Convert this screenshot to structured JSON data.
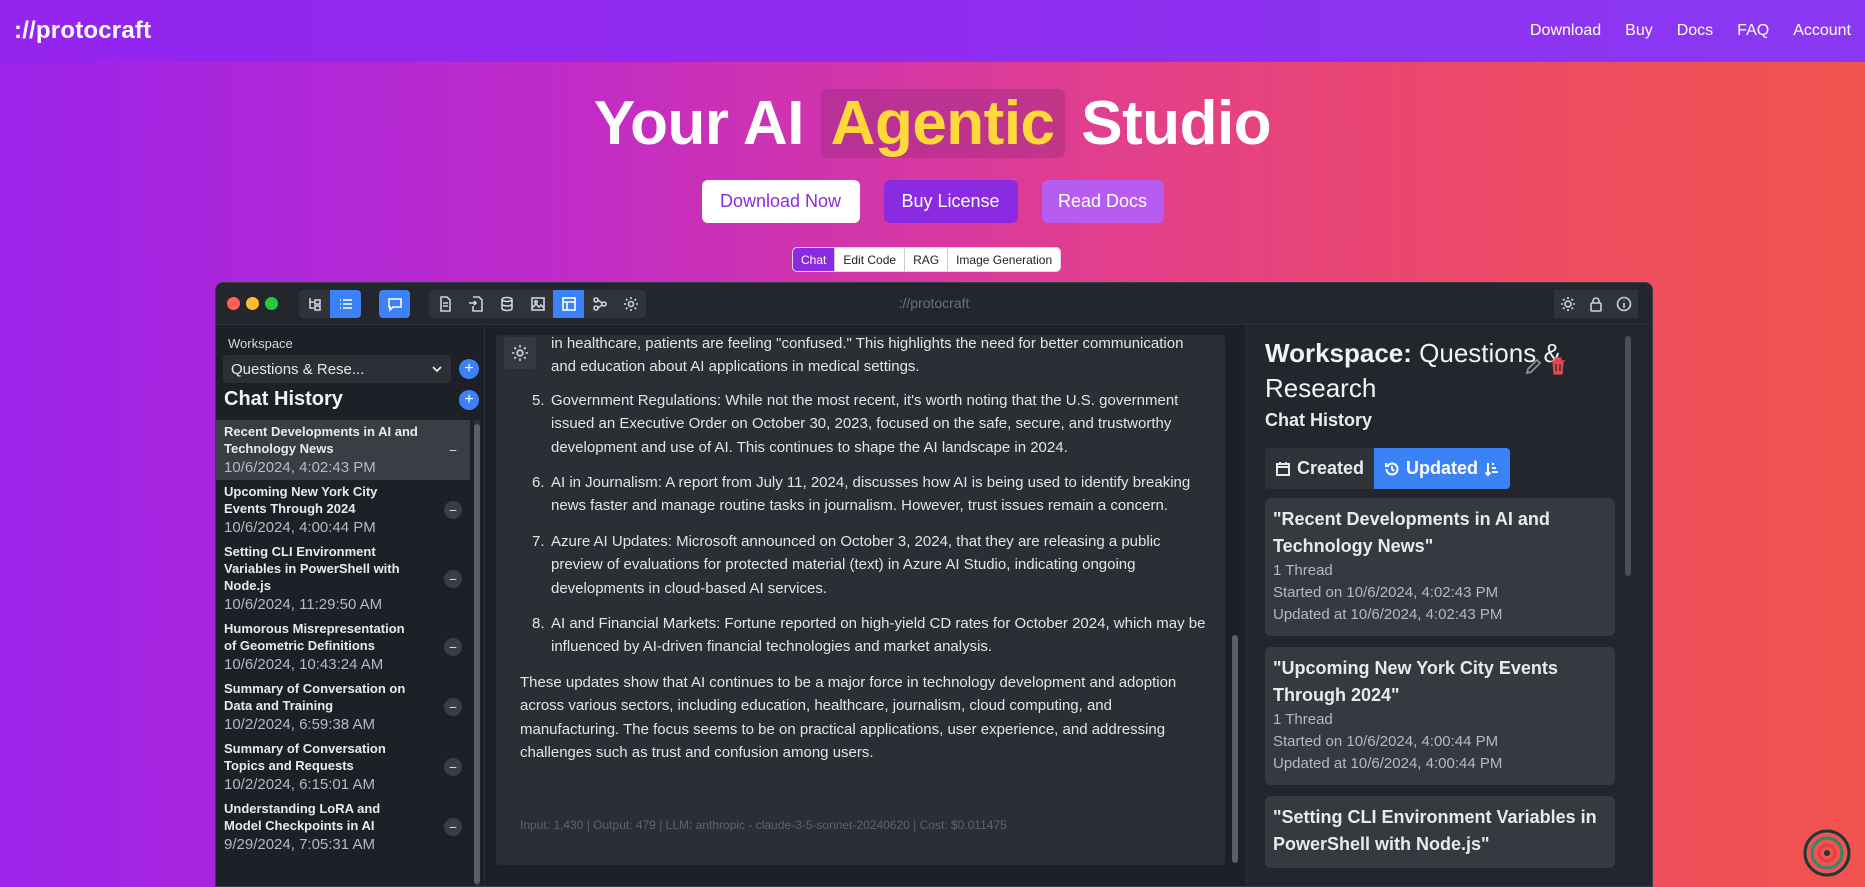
{
  "nav": {
    "logo": "://protocraft",
    "links": [
      "Download",
      "Buy",
      "Docs",
      "FAQ",
      "Account"
    ]
  },
  "hero": {
    "title_pre": "Your AI",
    "title_highlight": "Agentic",
    "title_post": "Studio",
    "buttons": [
      "Download Now",
      "Buy License",
      "Read Docs"
    ],
    "mode_tabs": [
      "Chat",
      "Edit Code",
      "RAG",
      "Image Generation"
    ],
    "active_tab": "Chat"
  },
  "window": {
    "title": "://protocraft"
  },
  "sidebar": {
    "workspace_label": "Workspace",
    "workspace_value": "Questions & Rese...",
    "chat_history_title": "Chat History",
    "chats": [
      {
        "title": "Recent Developments in AI and Technology News",
        "date": "10/6/2024, 4:02:43 PM"
      },
      {
        "title": "Upcoming New York City Events Through 2024",
        "date": "10/6/2024, 4:00:44 PM"
      },
      {
        "title": "Setting CLI Environment Variables in PowerShell with Node.js",
        "date": "10/6/2024, 11:29:50 AM"
      },
      {
        "title": "Humorous Misrepresentation of Geometric Definitions",
        "date": "10/6/2024, 10:43:24 AM"
      },
      {
        "title": "Summary of Conversation on Data and Training",
        "date": "10/2/2024, 6:59:38 AM"
      },
      {
        "title": "Summary of Conversation Topics and Requests",
        "date": "10/2/2024, 6:15:01 AM"
      },
      {
        "title": "Understanding LoRA and Model Checkpoints in AI",
        "date": "9/29/2024, 7:05:31 AM"
      }
    ]
  },
  "chat": {
    "intro": "in healthcare, patients are feeling \"confused.\" This highlights the need for better communication and education about AI applications in medical settings.",
    "items": [
      {
        "num": "5.",
        "text": "Government Regulations: While not the most recent, it's worth noting that the U.S. government issued an Executive Order on October 30, 2023, focused on the safe, secure, and trustworthy development and use of AI. This continues to shape the AI landscape in 2024."
      },
      {
        "num": "6.",
        "text": "AI in Journalism: A report from July 11, 2024, discusses how AI is being used to identify breaking news faster and manage routine tasks in journalism. However, trust issues remain a concern."
      },
      {
        "num": "7.",
        "text": "Azure AI Updates: Microsoft announced on October 3, 2024, that they are releasing a public preview of evaluations for protected material (text) in Azure AI Studio, indicating ongoing developments in cloud-based AI services."
      },
      {
        "num": "8.",
        "text": "AI and Financial Markets: Fortune reported on high-yield CD rates for October 2024, which may be influenced by AI-driven financial technologies and market analysis."
      }
    ],
    "summary": "These updates show that AI continues to be a major force in technology development and adoption across various sectors, including education, healthcare, journalism, cloud computing, and manufacturing. The focus seems to be on practical applications, user experience, and addressing challenges such as trust and confusion among users.",
    "footer": "Input: 1,430 | Output: 479 | LLM: anthropic - claude-3-5-sonnet-20240620 | Cost: $0.011475"
  },
  "right": {
    "heading_bold": "Workspace:",
    "heading_rest": "Questions & Research",
    "chat_history_title": "Chat History",
    "sort_created": "Created",
    "sort_updated": "Updated",
    "cards": [
      {
        "title": "\"Recent Developments in AI and Technology News\"",
        "threads": "1 Thread",
        "started": "Started on 10/6/2024, 4:02:43 PM",
        "updated": "Updated at 10/6/2024, 4:02:43 PM"
      },
      {
        "title": "\"Upcoming New York City Events Through 2024\"",
        "threads": "1 Thread",
        "started": "Started on 10/6/2024, 4:00:44 PM",
        "updated": "Updated at 10/6/2024, 4:00:44 PM"
      },
      {
        "title": "\"Setting CLI Environment Variables in PowerShell with Node.js\"",
        "threads": "",
        "started": "",
        "updated": ""
      }
    ]
  },
  "colors": {
    "accent": "#3b82f6",
    "brand_purple": "#8a2be2",
    "highlight_yellow": "#ffd93a"
  }
}
